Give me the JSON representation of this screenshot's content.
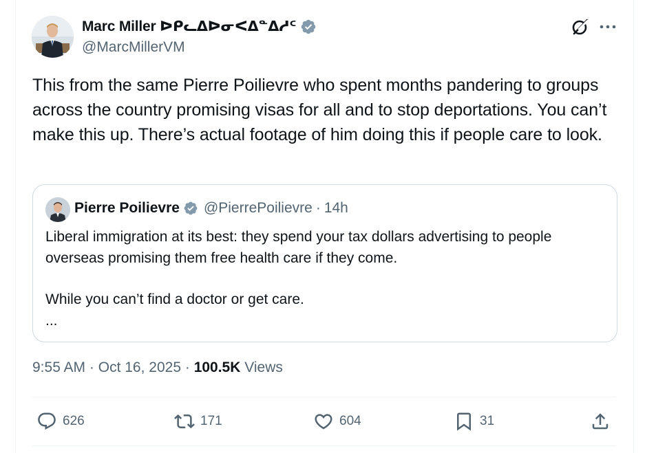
{
  "author": {
    "display_name": "Marc Miller ᐅᑭᓚᐃᐅᓂᐸᐃᓐᐃᓱᑦ",
    "handle": "@MarcMillerVM",
    "verified": true
  },
  "tweet": {
    "text": "This from the same Pierre Poilievre who spent months pandering to groups across the country promising visas for all and to stop deportations. You can’t make this up. There’s actual footage of him doing this if people care to look."
  },
  "quote": {
    "display_name": "Pierre Poilievre",
    "handle": "@PierrePoilievre",
    "separator": "·",
    "time": "14h",
    "verified": true,
    "paragraph1": "Liberal immigration at its best: they spend your tax dollars advertising to people overseas promising them free health care if they come.",
    "paragraph2": "While you can’t find a doctor or get care.",
    "truncation": "..."
  },
  "meta": {
    "time": "9:55 AM",
    "sep1": "·",
    "date": "Oct 16, 2025",
    "sep2": "·",
    "views_count": "100.5K",
    "views_label": "Views"
  },
  "actions": {
    "replies": "626",
    "reposts": "171",
    "likes": "604",
    "bookmarks": "31"
  },
  "colors": {
    "verified_badge": "#829aab",
    "text_primary": "#0f1419",
    "text_secondary": "#536471",
    "border": "#cfd9de"
  },
  "icons": [
    "grok-icon",
    "more-icon",
    "verified-badge-icon",
    "reply-icon",
    "repost-icon",
    "like-icon",
    "bookmark-icon",
    "share-icon"
  ]
}
